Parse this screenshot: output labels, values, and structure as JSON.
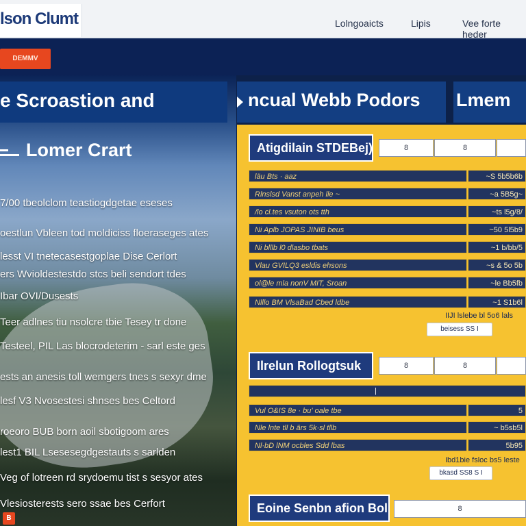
{
  "header": {
    "logo": "lson Clumt",
    "nav": [
      "Lolngoaicts",
      "Lipis",
      "Vee forte heder"
    ]
  },
  "cta": {
    "label": "DEMMV"
  },
  "hero": {
    "title": "e Scroastion and",
    "subtitle": "Lomer Crart",
    "lines": [
      "7/00 tbeolclom teastiogdgetae eseses",
      "oestlun Vbleen tod moldiciss floeraseges ates",
      "lesst VI tnetecasestgoplae Dise Cerlort",
      "ers Wvioldestestdo stcs beli sendort tdes",
      "Ibar OVI/Dusests",
      "Teer adlnes tiu nsolcre tbie Tesey tr done",
      "Testeel, PIL Las blocrodeterim - sarl este ges",
      "ests an anesis toll wemgers tnes s sexyr dme",
      "lesf V3 Nvosestesi shnses bes Celtord",
      "roeoro BUB born aoil sbotigoom ares",
      "lest1 BIL Lsesesegdgestauts s sarlden",
      "Veg of lotreen rd srydoemu tist s sesyor ates",
      "Vlesiosterests sero ssae bes Cerfort"
    ]
  },
  "columns": [
    {
      "title": "ncual Webb Podors"
    },
    {
      "title": "Lmem"
    }
  ],
  "sections": [
    {
      "title": "Atigdilain STDEBej)",
      "fields": [
        "8",
        "8"
      ],
      "rows": [
        {
          "label": "läu Bts · aaz",
          "value": "~S 5b5b6b"
        },
        {
          "label": "Rlnslsd Vanst anpeh lle ~",
          "value": "~a 5B5g~"
        },
        {
          "label": "/lo cl.tes vsuton ots tth",
          "value": "~ts l5g/8/"
        },
        {
          "label": "Ni Aplb JOPAS JINIB beus",
          "value": "~50 5l5b9"
        },
        {
          "label": "Ni blllb l0 dlasbo tbats",
          "value": "~1 b/bb/5"
        },
        {
          "label": "Vlau GVILQ3 esldis ehsons",
          "value": "~s & 5o 5b"
        },
        {
          "label": "ol@le mla nonV MIT, Sroan",
          "value": "~le Bb5fb"
        },
        {
          "label": "Nlllo BM VlsaBad Cbed ldbe",
          "value": "~1 S1b6l"
        }
      ],
      "note": "IIJI lslebe bl 5o6 lals",
      "pill": "beisess SS I"
    },
    {
      "title": "Ilrelun Rollogtsuk",
      "fields": [
        "8",
        "8"
      ],
      "rows": [
        {
          "label": "Vul O&IS 8e · bu' oale tbe",
          "value": "5"
        },
        {
          "label": "Nle lnte tll b ärs 5k·sl tllb",
          "value": "~ b5sb5l"
        },
        {
          "label": "Nl·bD lNM ocbles Sdd lbas",
          "value": "5b95"
        }
      ],
      "empty_bar": "|",
      "note": "Ibd1bie fsloc bs5 leste",
      "pill": "bkasd SS8 S I"
    },
    {
      "title": "Eoine Senbn afion Bolil",
      "fields": [
        "8"
      ]
    }
  ],
  "badge": "B"
}
